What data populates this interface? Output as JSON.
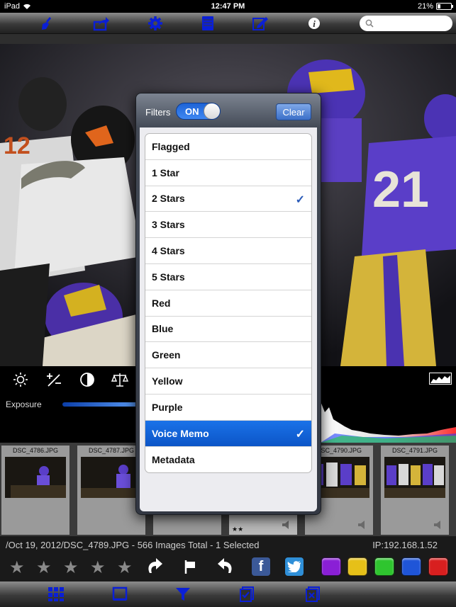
{
  "status_bar": {
    "device": "iPad",
    "time": "12:47 PM",
    "battery": "21%",
    "battery_level": 0.21
  },
  "top_toolbar": {
    "icons": [
      "broom-icon",
      "share-icon",
      "gear-icon",
      "document-icon",
      "edit-icon",
      "info-icon"
    ],
    "search": {
      "value": "",
      "placeholder": ""
    }
  },
  "adjustments": {
    "icons": [
      "brightness-icon",
      "exposure-compensation-icon",
      "contrast-icon",
      "white-balance-icon"
    ],
    "exposure_label": "Exposure",
    "exposure_level": 0.9
  },
  "filmstrip": {
    "thumbnails": [
      {
        "name": "DSC_4786.JPG",
        "stars": "",
        "voice_memo": false
      },
      {
        "name": "DSC_4787.JPG",
        "stars": "",
        "voice_memo": false
      },
      {
        "name": "",
        "stars": "",
        "voice_memo": false
      },
      {
        "name": "",
        "stars": "★★",
        "voice_memo": true
      },
      {
        "name": "DSC_4790.JPG",
        "stars": "",
        "voice_memo": true
      },
      {
        "name": "DSC_4791.JPG",
        "stars": "",
        "voice_memo": true
      }
    ]
  },
  "info_bar": {
    "path": "/Oct 19, 2012/DSC_4789.JPG - 566 Images Total - 1 Selected",
    "ip": "IP:192.168.1.52"
  },
  "rating_bar": {
    "stars": [
      "★",
      "★",
      "★",
      "★",
      "★"
    ],
    "rotate_cw_icon": "rotate-right-icon",
    "flag_icon": "flag-icon",
    "rotate_ccw_icon": "rotate-left-icon",
    "facebook_label": "f",
    "facebook_color": "#3b5998",
    "twitter_color": "#2f8fd8",
    "color_labels": [
      "#8a1fd6",
      "#e6c018",
      "#2fc52f",
      "#1f55d8",
      "#d81f1f"
    ]
  },
  "bottom_toolbar": {
    "icons": [
      "grid-view-icon",
      "single-view-icon",
      "filter-icon",
      "select-all-icon",
      "deselect-icon"
    ],
    "accent_color": "#0a1fd6"
  },
  "filter_popover": {
    "title": "Filters",
    "toggle_label": "ON",
    "toggle_on": true,
    "clear_label": "Clear",
    "items": [
      {
        "label": "Flagged",
        "checked": false,
        "selected": false
      },
      {
        "label": "1 Star",
        "checked": false,
        "selected": false
      },
      {
        "label": "2 Stars",
        "checked": true,
        "selected": false
      },
      {
        "label": "3 Stars",
        "checked": false,
        "selected": false
      },
      {
        "label": "4 Stars",
        "checked": false,
        "selected": false
      },
      {
        "label": "5 Stars",
        "checked": false,
        "selected": false
      },
      {
        "label": "Red",
        "checked": false,
        "selected": false
      },
      {
        "label": "Blue",
        "checked": false,
        "selected": false
      },
      {
        "label": "Green",
        "checked": false,
        "selected": false
      },
      {
        "label": "Yellow",
        "checked": false,
        "selected": false
      },
      {
        "label": "Purple",
        "checked": false,
        "selected": false
      },
      {
        "label": "Voice Memo",
        "checked": true,
        "selected": true
      },
      {
        "label": "Metadata",
        "checked": false,
        "selected": false
      }
    ],
    "checkmark": "✓"
  }
}
